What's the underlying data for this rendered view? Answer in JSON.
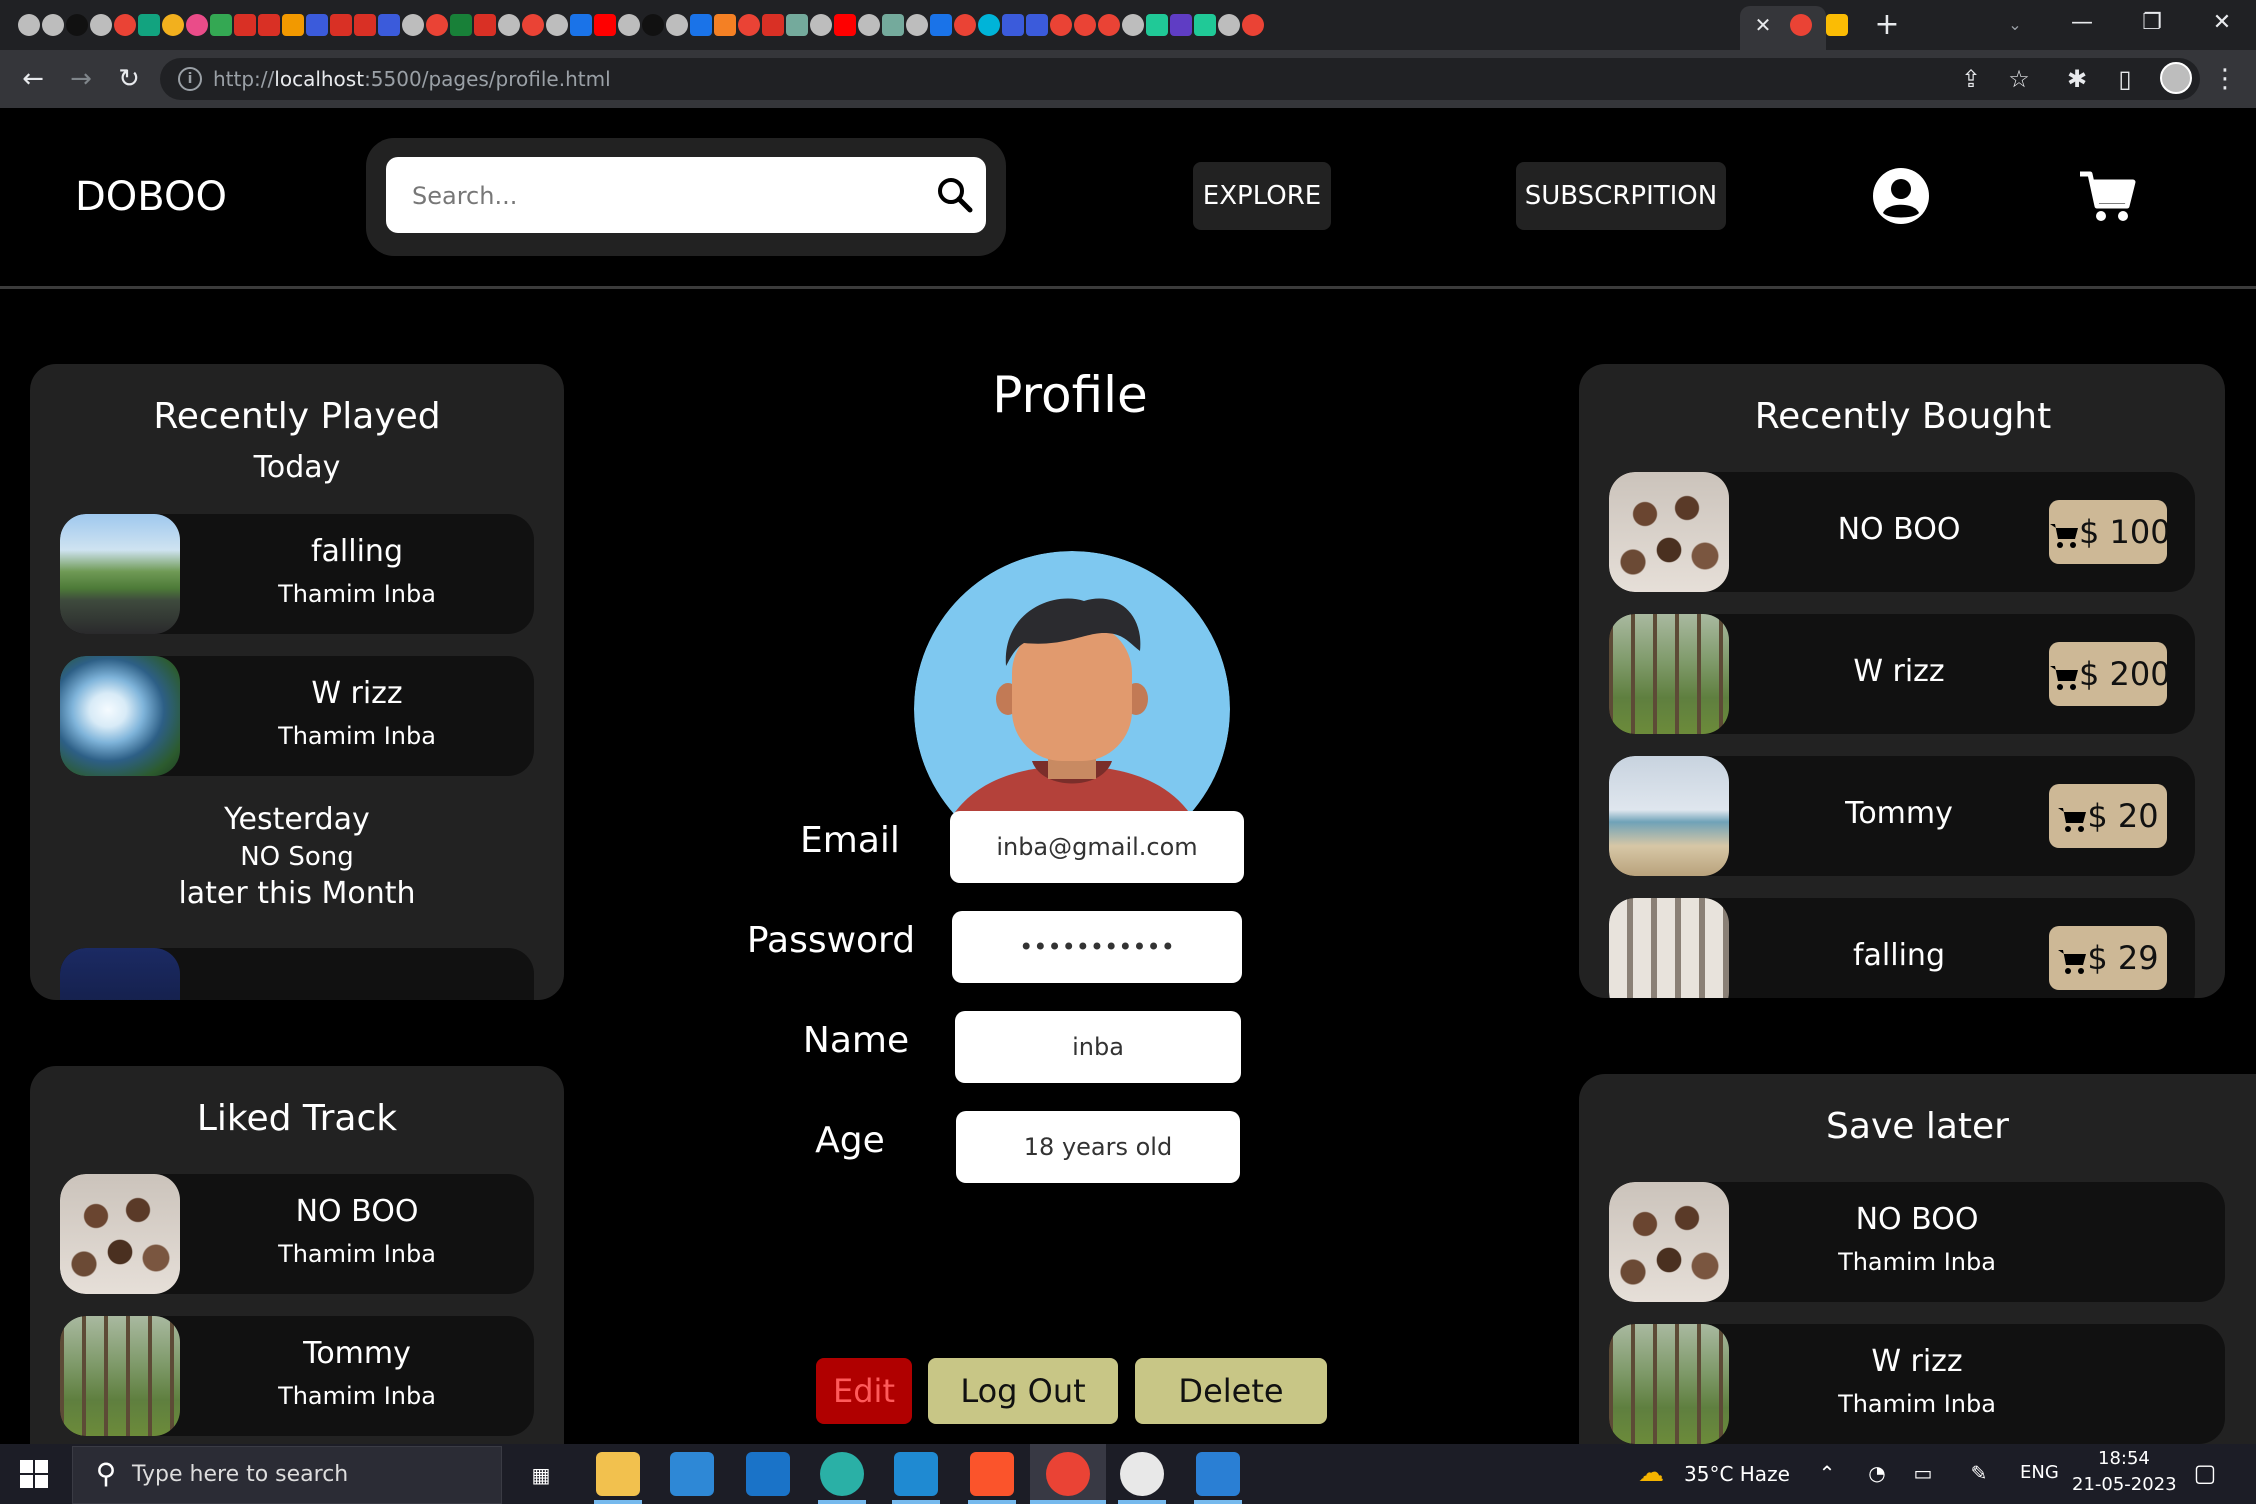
{
  "browser": {
    "url_prefix": "http://",
    "url_host": "localhost",
    "url_rest": ":5500/pages/profile.html",
    "tab_close": "✕",
    "new_tab": "+",
    "tab_search": "⌄",
    "window_controls": {
      "minimize": "—",
      "restore": "❐",
      "close": "✕"
    },
    "nav": {
      "back": "←",
      "forward": "→",
      "reload": "↻"
    },
    "tools": {
      "share": "⇪",
      "bookmark": "☆",
      "extensions": "✱",
      "sidepanel": "▯",
      "menu": "⋮"
    },
    "icons": [
      "back-icon",
      "forward-icon",
      "reload-icon",
      "info-icon",
      "share-icon",
      "star-icon",
      "extensions-icon",
      "side-panel-icon",
      "menu-icon"
    ]
  },
  "header": {
    "brand": "DOBOO",
    "search_placeholder": "Search...",
    "nav": [
      {
        "label": "EXPLORE"
      },
      {
        "label": "SUBSCRPITION"
      }
    ]
  },
  "recently_played": {
    "title": "Recently Played",
    "today_label": "Today",
    "today_items": [
      {
        "title": "falling",
        "artist": "Thamim Inba"
      },
      {
        "title": "W rizz",
        "artist": "Thamim Inba"
      }
    ],
    "yesterday_label": "Yesterday",
    "yesterday_text": "NO Song",
    "month_label": "later this Month"
  },
  "liked_tracks": {
    "title": "Liked Track",
    "items": [
      {
        "title": "NO BOO",
        "artist": "Thamim Inba"
      },
      {
        "title": "Tommy",
        "artist": "Thamim Inba"
      }
    ]
  },
  "profile": {
    "title": "Profile",
    "fields": {
      "email_label": "Email",
      "email_value": "inba@gmail.com",
      "password_label": "Password",
      "password_value": "•••••••••••",
      "name_label": "Name",
      "name_value": "inba",
      "age_label": "Age",
      "age_value": "18 years old"
    },
    "buttons": {
      "edit": "Edit",
      "logout": "Log Out",
      "delete": "Delete"
    }
  },
  "recently_bought": {
    "title": "Recently Bought",
    "items": [
      {
        "title": "NO BOO",
        "price": "$ 100"
      },
      {
        "title": "W rizz",
        "price": "$ 200"
      },
      {
        "title": "Tommy",
        "price": "$ 20"
      },
      {
        "title": "falling",
        "price": "$ 29"
      }
    ]
  },
  "save_later": {
    "title": "Save later",
    "items": [
      {
        "title": "NO BOO",
        "artist": "Thamim Inba"
      },
      {
        "title": "W rizz",
        "artist": "Thamim Inba"
      }
    ]
  },
  "taskbar": {
    "search_placeholder": "Type here to search",
    "weather": "35°C  Haze",
    "language": "ENG",
    "time": "18:54",
    "date": "21-05-2023"
  },
  "colors": {
    "page_bg": "#000000",
    "panel_bg": "#222222",
    "card_bg": "#111111",
    "price_tag": "#cdb896",
    "edit_button": "#b00000",
    "action_button": "#c8c686",
    "avatar_bg": "#7ec8f0"
  }
}
